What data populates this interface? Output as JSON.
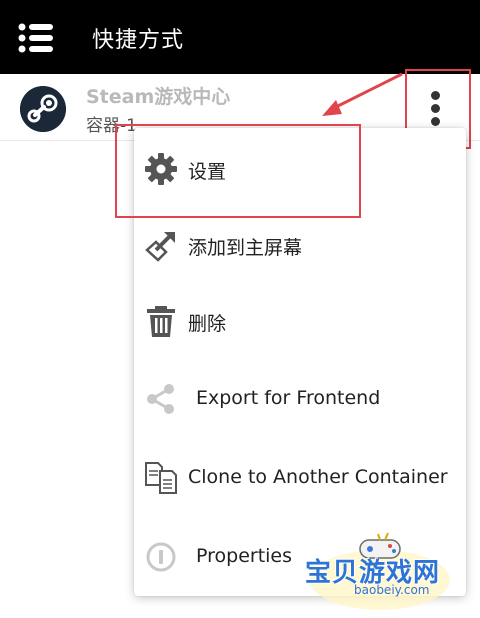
{
  "appbar": {
    "title": "快捷方式",
    "menu_icon": "hamburger-icon"
  },
  "shortcut": {
    "name": "Steam游戏中心",
    "container": "容器-1",
    "avatar_icon": "steam-icon",
    "overflow_icon": "more-vert-icon"
  },
  "menu": {
    "items": [
      {
        "label": "设置",
        "icon": "gear-icon"
      },
      {
        "label": "添加到主屏幕",
        "icon": "add-to-home-icon"
      },
      {
        "label": "删除",
        "icon": "trash-icon"
      },
      {
        "label": "Export for Frontend",
        "icon": "share-icon"
      },
      {
        "label": "Clone to Another Container",
        "icon": "clone-icon"
      },
      {
        "label": "Properties",
        "icon": "info-icon"
      }
    ]
  },
  "watermark": {
    "text": "宝贝游戏网",
    "url": "baobeiy.com"
  },
  "colors": {
    "appbar": "#000000",
    "highlight": "#e0444c",
    "watermark": "#2e73d6"
  }
}
